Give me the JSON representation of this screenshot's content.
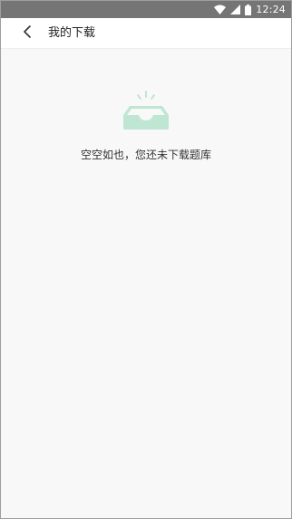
{
  "status_bar": {
    "time": "12:24",
    "icons": [
      "wifi-icon",
      "signal-icon",
      "battery-icon"
    ]
  },
  "header": {
    "back_icon": "chevron-left-icon",
    "title": "我的下载"
  },
  "empty_state": {
    "icon": "empty-tray-icon",
    "message": "空空如也，您还未下载题库",
    "accent_color": "#bfe6d3"
  },
  "colors": {
    "status_bar_bg": "#757575",
    "page_bg": "#f8f8f8",
    "header_bg": "#ffffff"
  }
}
